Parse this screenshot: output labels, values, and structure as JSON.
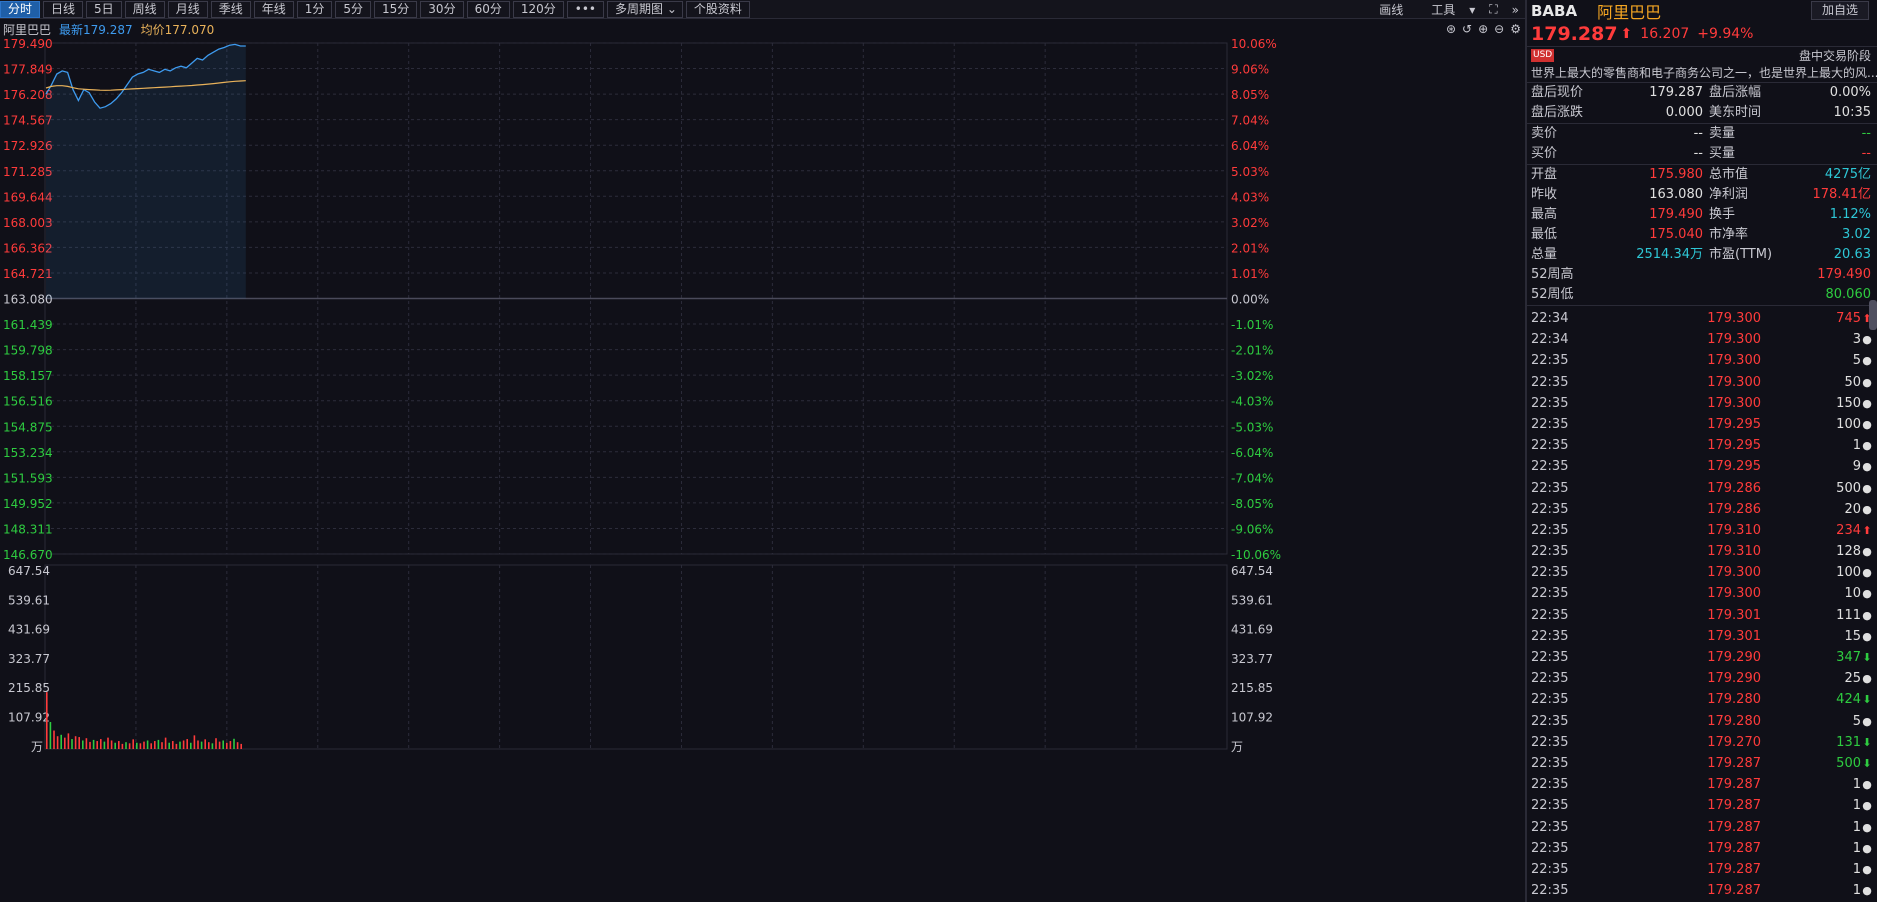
{
  "toolbar": {
    "tabs": [
      "分时",
      "日线",
      "5日",
      "周线",
      "月线",
      "季线",
      "年线",
      "1分",
      "5分",
      "15分",
      "30分",
      "60分",
      "120分",
      "•••"
    ],
    "multi_period": "多周期图",
    "stock_info": "个股资料",
    "draw": "画线",
    "tools": "工具",
    "fullscreen_icon": "⛶",
    "collapse_icon": "»"
  },
  "infobar": {
    "name": "阿里巴巴",
    "latest": "最新179.287",
    "avg": "均价177.070"
  },
  "chart_data": {
    "type": "line",
    "title": "",
    "y_left_labels": [
      "179.490",
      "177.849",
      "176.208",
      "174.567",
      "172.926",
      "171.285",
      "169.644",
      "168.003",
      "166.362",
      "164.721",
      "163.080",
      "161.439",
      "159.798",
      "158.157",
      "156.516",
      "154.875",
      "153.234",
      "151.593",
      "149.952",
      "148.311",
      "146.670"
    ],
    "y_right_labels": [
      "10.06%",
      "9.06%",
      "8.05%",
      "7.04%",
      "6.04%",
      "5.03%",
      "4.03%",
      "3.02%",
      "2.01%",
      "1.01%",
      "0.00%",
      "-1.01%",
      "-2.01%",
      "-3.02%",
      "-4.03%",
      "-5.03%",
      "-6.04%",
      "-7.04%",
      "-8.05%",
      "-9.06%",
      "-10.06%"
    ],
    "ylim": [
      146.67,
      179.49
    ],
    "prev_close": 163.08,
    "price_series": [
      176.2,
      176.8,
      177.5,
      177.7,
      177.6,
      176.5,
      175.8,
      176.5,
      176.3,
      175.7,
      175.3,
      175.4,
      175.6,
      175.9,
      176.3,
      176.8,
      177.3,
      177.5,
      177.6,
      177.8,
      177.7,
      177.6,
      177.8,
      177.7,
      177.9,
      178.0,
      177.9,
      178.2,
      178.5,
      178.4,
      178.7,
      178.9,
      179.1,
      179.2,
      179.35,
      179.4,
      179.3,
      179.3
    ],
    "avg_series": [
      176.6,
      176.7,
      176.75,
      176.75,
      176.7,
      176.62,
      176.55,
      176.52,
      176.5,
      176.48,
      176.46,
      176.45,
      176.46,
      176.48,
      176.5,
      176.52,
      176.54,
      176.56,
      176.58,
      176.6,
      176.62,
      176.64,
      176.66,
      176.68,
      176.7,
      176.72,
      176.74,
      176.76,
      176.79,
      176.82,
      176.85,
      176.88,
      176.92,
      176.96,
      177.0,
      177.03,
      177.05,
      177.07
    ],
    "series": [
      {
        "name": "最新",
        "color": "#3e9bef"
      },
      {
        "name": "均价",
        "color": "#e9b25a"
      }
    ],
    "volume_labels": [
      "647.54",
      "539.61",
      "431.69",
      "323.77",
      "215.85",
      "107.92",
      "万"
    ],
    "volume_max": 647.54,
    "volume_series": [
      200,
      95,
      65,
      45,
      50,
      40,
      55,
      35,
      45,
      42,
      30,
      38,
      25,
      32,
      28,
      35,
      26,
      40,
      30,
      22,
      28,
      18,
      24,
      20,
      34,
      22,
      20,
      26,
      30,
      20,
      28,
      32,
      24,
      40,
      22,
      28,
      18,
      26,
      30,
      35,
      22,
      48,
      30,
      26,
      34,
      24,
      20,
      38,
      26,
      30,
      22,
      28,
      36,
      24,
      18
    ],
    "volume_colors": [
      "#ff3b3b",
      "#2ecc40"
    ]
  },
  "quote": {
    "code": "BABA",
    "name": "阿里巴巴",
    "add_watch": "加自选",
    "price": "179.287",
    "change": "16.207",
    "pct": "+9.94%",
    "currency": "USD",
    "phase": "盘中交易阶段",
    "description": "世界上最大的零售商和电子商务公司之一，也是世界上最大的风...",
    "after_rows": [
      {
        "l": "盘后现价",
        "v": "179.287",
        "l2": "盘后涨幅",
        "v2": "0.00%"
      },
      {
        "l": "盘后涨跌",
        "v": "0.000",
        "l2": "美东时间",
        "v2": "10:35"
      }
    ],
    "bidask": [
      {
        "l": "卖价",
        "v": "--",
        "l2": "卖量",
        "v2": "--"
      },
      {
        "l": "买价",
        "v": "--",
        "l2": "买量",
        "v2": "--"
      }
    ],
    "stats": [
      {
        "l": "开盘",
        "v": "175.980",
        "l2": "总市值",
        "v2": "4275亿"
      },
      {
        "l": "昨收",
        "v": "163.080",
        "l2": "净利润",
        "v2": "178.41亿"
      },
      {
        "l": "最高",
        "v": "179.490",
        "l2": "换手",
        "v2": "1.12%"
      },
      {
        "l": "最低",
        "v": "175.040",
        "l2": "市净率",
        "v2": "3.02"
      },
      {
        "l": "总量",
        "v": "2514.34万",
        "l2": "市盈(TTM)",
        "v2": "20.63"
      },
      {
        "l": "52周高",
        "v": "",
        "l2": "",
        "v2": "179.490"
      },
      {
        "l": "52周低",
        "v": "",
        "l2": "",
        "v2": "80.060"
      }
    ],
    "ticks": [
      {
        "t": "22:34",
        "p": "179.300",
        "q": "745",
        "dir": "up"
      },
      {
        "t": "22:34",
        "p": "179.300",
        "q": "3",
        "dir": "flat"
      },
      {
        "t": "22:35",
        "p": "179.300",
        "q": "5",
        "dir": "flat"
      },
      {
        "t": "22:35",
        "p": "179.300",
        "q": "50",
        "dir": "flat"
      },
      {
        "t": "22:35",
        "p": "179.300",
        "q": "150",
        "dir": "flat"
      },
      {
        "t": "22:35",
        "p": "179.295",
        "q": "100",
        "dir": "flat"
      },
      {
        "t": "22:35",
        "p": "179.295",
        "q": "1",
        "dir": "flat"
      },
      {
        "t": "22:35",
        "p": "179.295",
        "q": "9",
        "dir": "flat"
      },
      {
        "t": "22:35",
        "p": "179.286",
        "q": "500",
        "dir": "flat"
      },
      {
        "t": "22:35",
        "p": "179.286",
        "q": "20",
        "dir": "flat"
      },
      {
        "t": "22:35",
        "p": "179.310",
        "q": "234",
        "dir": "up"
      },
      {
        "t": "22:35",
        "p": "179.310",
        "q": "128",
        "dir": "flat"
      },
      {
        "t": "22:35",
        "p": "179.300",
        "q": "100",
        "dir": "flat"
      },
      {
        "t": "22:35",
        "p": "179.300",
        "q": "10",
        "dir": "flat"
      },
      {
        "t": "22:35",
        "p": "179.301",
        "q": "111",
        "dir": "flat"
      },
      {
        "t": "22:35",
        "p": "179.301",
        "q": "15",
        "dir": "flat"
      },
      {
        "t": "22:35",
        "p": "179.290",
        "q": "347",
        "dir": "down"
      },
      {
        "t": "22:35",
        "p": "179.290",
        "q": "25",
        "dir": "flat"
      },
      {
        "t": "22:35",
        "p": "179.280",
        "q": "424",
        "dir": "down"
      },
      {
        "t": "22:35",
        "p": "179.280",
        "q": "5",
        "dir": "flat"
      },
      {
        "t": "22:35",
        "p": "179.270",
        "q": "131",
        "dir": "down"
      },
      {
        "t": "22:35",
        "p": "179.287",
        "q": "500",
        "dir": "down"
      },
      {
        "t": "22:35",
        "p": "179.287",
        "q": "1",
        "dir": "flat"
      },
      {
        "t": "22:35",
        "p": "179.287",
        "q": "1",
        "dir": "flat"
      },
      {
        "t": "22:35",
        "p": "179.287",
        "q": "1",
        "dir": "flat"
      },
      {
        "t": "22:35",
        "p": "179.287",
        "q": "1",
        "dir": "flat"
      },
      {
        "t": "22:35",
        "p": "179.287",
        "q": "1",
        "dir": "flat"
      },
      {
        "t": "22:35",
        "p": "179.287",
        "q": "1",
        "dir": "flat"
      }
    ]
  },
  "colors": {
    "up": "#ff3b3b",
    "down": "#2ecc40",
    "accent": "#1f5fa8",
    "price_line": "#3e9bef",
    "avg_line": "#e9b25a",
    "bg": "#101018"
  }
}
